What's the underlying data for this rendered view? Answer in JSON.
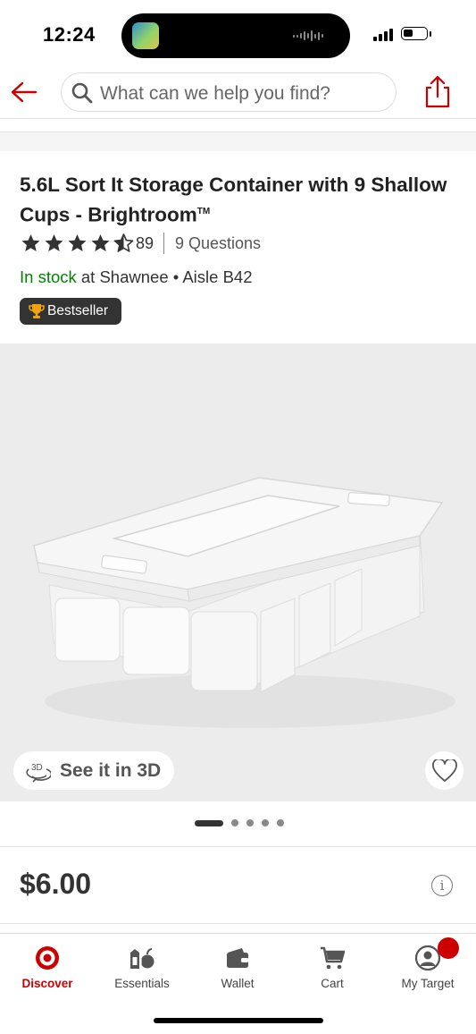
{
  "status_bar": {
    "time": "12:24"
  },
  "header": {
    "search_placeholder": "What can we help you find?"
  },
  "product": {
    "title": "5.6L Sort It Storage Container with 9 Shallow Cups - Brightroom",
    "title_mark": "TM",
    "rating": 4.5,
    "rating_count": "89",
    "questions": "9 Questions",
    "stock_status": "In stock",
    "stock_location": " at Shawnee • Aisle B42",
    "badge": "Bestseller",
    "see_3d": "See it in 3D",
    "price": "$6.00",
    "image_count": 5,
    "active_image_index": 0
  },
  "tabs": [
    {
      "label": "Discover",
      "icon": "target-bullseye-icon",
      "active": true
    },
    {
      "label": "Essentials",
      "icon": "essentials-grocery-icon",
      "active": false
    },
    {
      "label": "Wallet",
      "icon": "wallet-icon",
      "active": false
    },
    {
      "label": "Cart",
      "icon": "cart-icon",
      "active": false
    },
    {
      "label": "My Target",
      "icon": "account-icon",
      "active": false
    }
  ],
  "colors": {
    "brand_red": "#cc0000",
    "in_stock_green": "#008300",
    "badge_bg": "#333333"
  }
}
